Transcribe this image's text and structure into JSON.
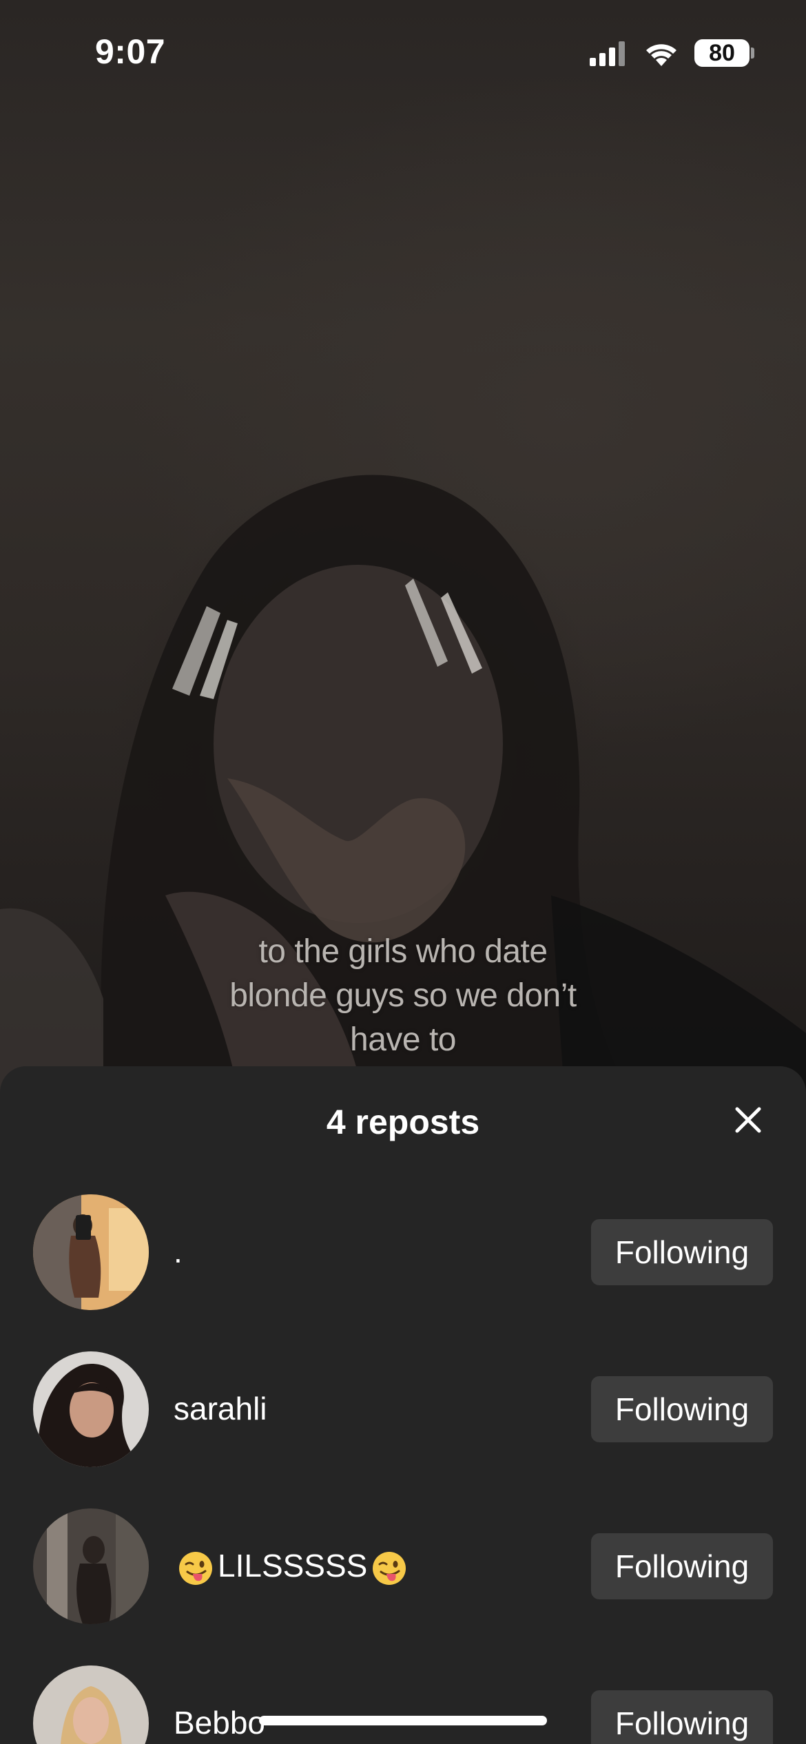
{
  "status_bar": {
    "time": "9:07",
    "battery": "80",
    "icons": [
      "cellular-signal-icon",
      "wifi-icon",
      "battery-icon"
    ]
  },
  "video": {
    "caption": "to the girls who date\nblonde guys so we don’t\nhave to"
  },
  "sheet": {
    "title": "4 reposts",
    "close_icon": "close-icon",
    "users": [
      {
        "name": ".",
        "button": "Following"
      },
      {
        "name": "sarahli",
        "button": "Following"
      },
      {
        "name_core": "LILSSSSS",
        "emoji": "winking-face-with-tongue",
        "button": "Following"
      },
      {
        "name": "Bebbo",
        "button": "Following"
      }
    ]
  },
  "colors": {
    "sheet_bg": "#252525",
    "button_bg": "#3d3d3d",
    "text": "#ffffff"
  }
}
